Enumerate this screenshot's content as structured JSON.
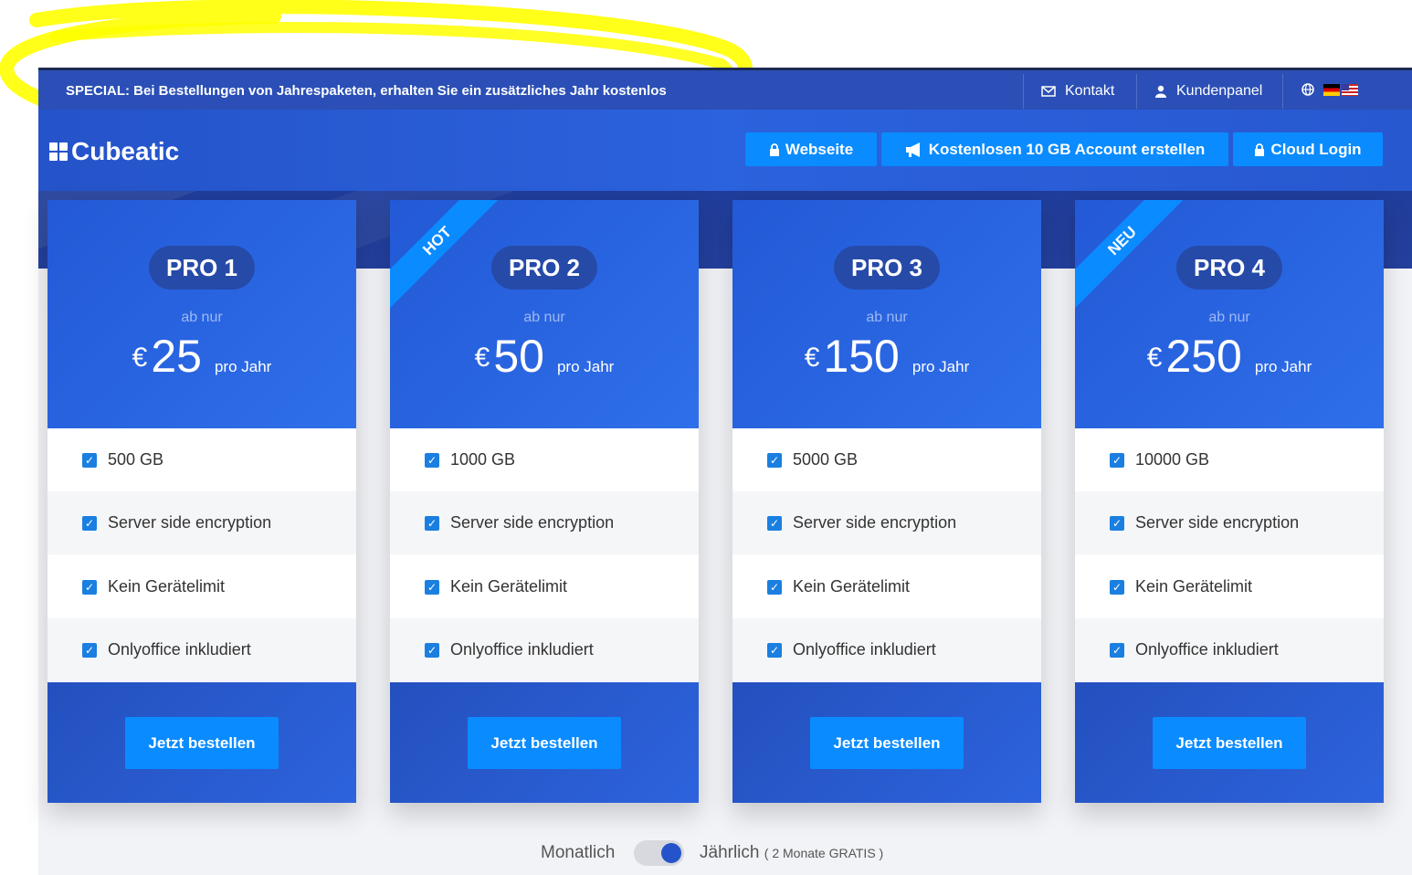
{
  "topbar": {
    "special": "SPECIAL: Bei Bestellungen von Jahrespaketen, erhalten Sie ein zusätzliches Jahr kostenlos",
    "kontakt": "Kontakt",
    "kundenpanel": "Kundenpanel"
  },
  "header": {
    "logo": "Cubeatic",
    "nav": [
      {
        "label": "Webseite",
        "icon": "lock-icon"
      },
      {
        "label": "Kostenlosen 10 GB Account erstellen",
        "icon": "megaphone-icon"
      },
      {
        "label": "Cloud Login",
        "icon": "lock-icon"
      }
    ]
  },
  "plans": [
    {
      "name": "PRO 1",
      "ab_nur": "ab nur",
      "currency": "€",
      "price": "25",
      "per": "pro Jahr",
      "ribbon": "",
      "features": [
        "500 GB",
        "Server side encryption",
        "Kein Gerätelimit",
        "Onlyoffice inkludiert"
      ],
      "button": "Jetzt bestellen"
    },
    {
      "name": "PRO 2",
      "ab_nur": "ab nur",
      "currency": "€",
      "price": "50",
      "per": "pro Jahr",
      "ribbon": "HOT",
      "features": [
        "1000 GB",
        "Server side encryption",
        "Kein Gerätelimit",
        "Onlyoffice inkludiert"
      ],
      "button": "Jetzt bestellen"
    },
    {
      "name": "PRO 3",
      "ab_nur": "ab nur",
      "currency": "€",
      "price": "150",
      "per": "pro Jahr",
      "ribbon": "",
      "features": [
        "5000 GB",
        "Server side encryption",
        "Kein Gerätelimit",
        "Onlyoffice inkludiert"
      ],
      "button": "Jetzt bestellen"
    },
    {
      "name": "PRO 4",
      "ab_nur": "ab nur",
      "currency": "€",
      "price": "250",
      "per": "pro Jahr",
      "ribbon": "NEU",
      "features": [
        "10000 GB",
        "Server side encryption",
        "Kein Gerätelimit",
        "Onlyoffice inkludiert"
      ],
      "button": "Jetzt bestellen"
    }
  ],
  "billing_toggle": {
    "monthly_label": "Monatlich",
    "yearly_label": "Jährlich",
    "yearly_note": "( 2 Monate GRATIS )",
    "selected": "Jährlich"
  },
  "colors": {
    "accent": "#0a8bff",
    "brand_blue": "#2b62dd",
    "annotation_yellow": "#ffff00"
  }
}
